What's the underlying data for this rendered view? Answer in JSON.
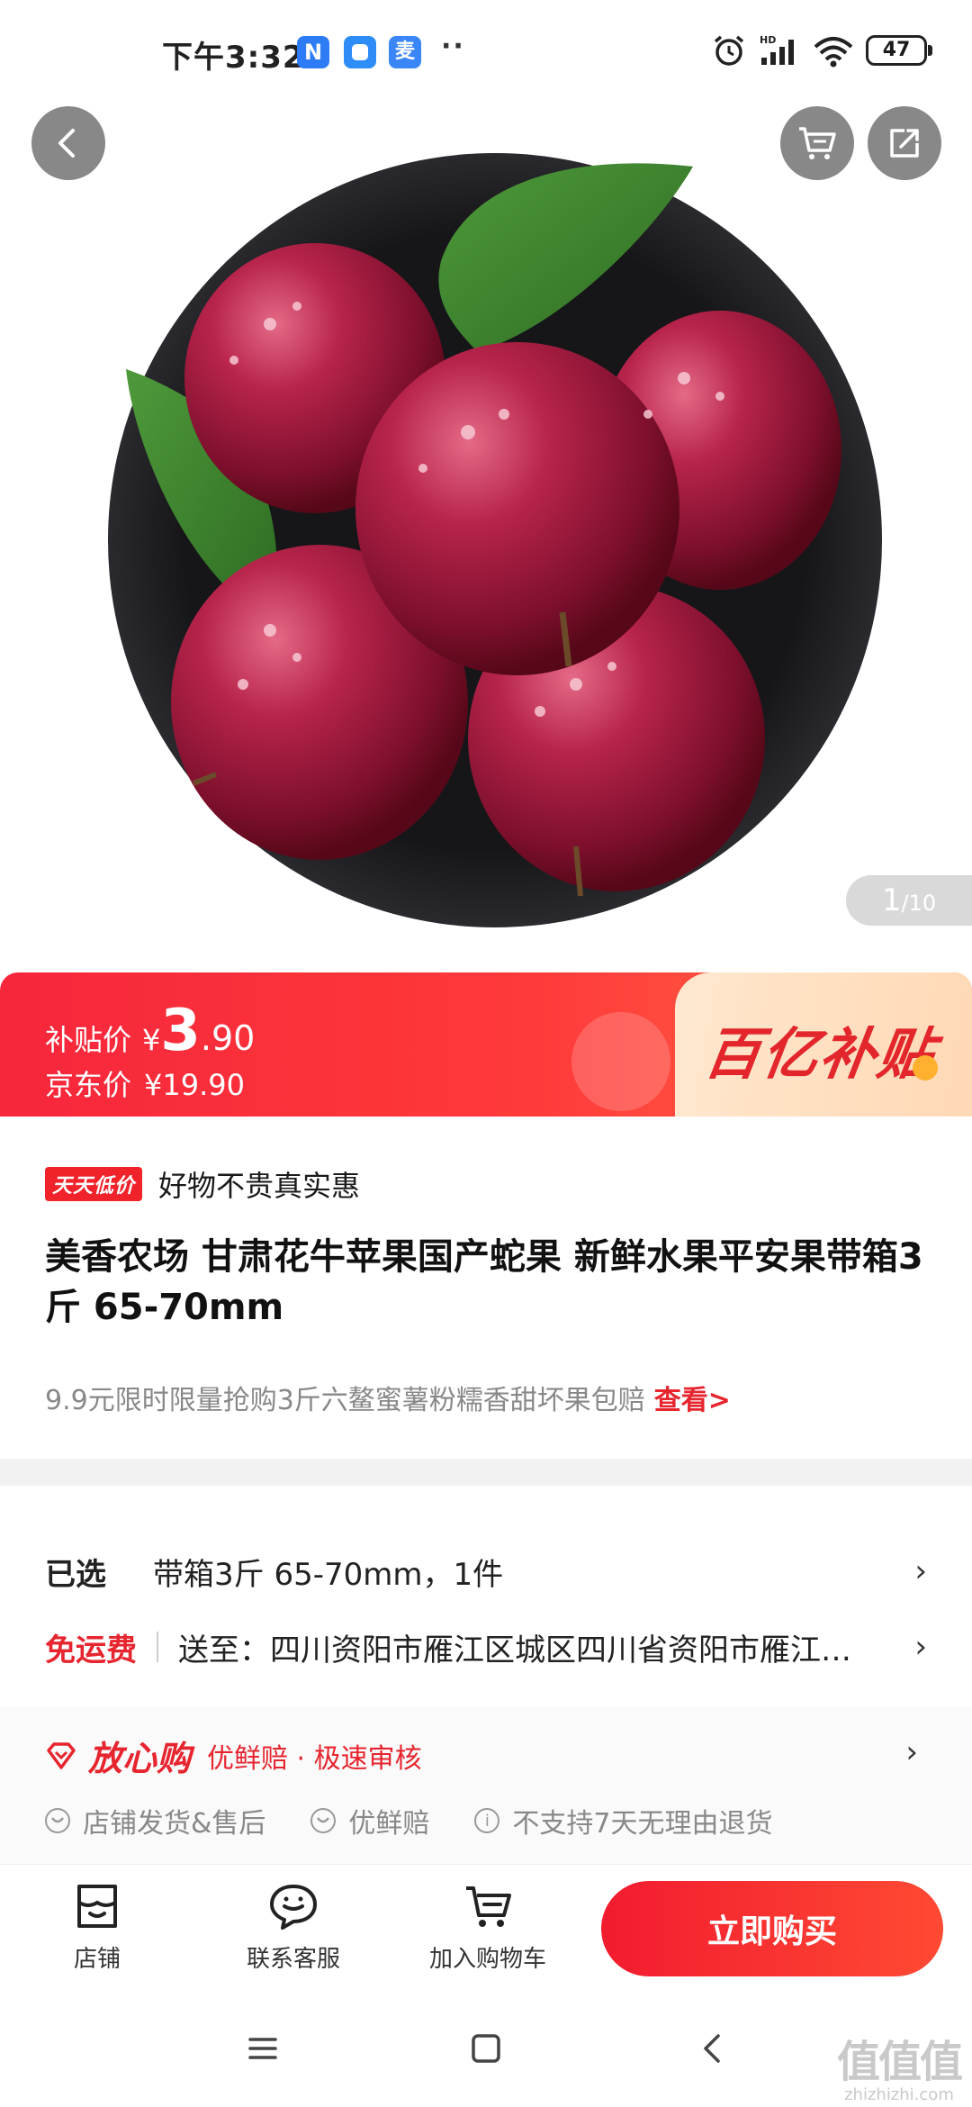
{
  "status_bar": {
    "time": "下午3:32",
    "app_badges": [
      {
        "name": "n-app",
        "glyph": "N",
        "color": "#2d7cf6"
      },
      {
        "name": "square-app",
        "glyph": "",
        "color": "#2d8cf6"
      },
      {
        "name": "mai-app",
        "glyph": "麦",
        "color": "#3b86f7"
      }
    ],
    "more": "··",
    "battery": "47"
  },
  "hero": {
    "page_current": "1",
    "page_total": "/10"
  },
  "price": {
    "subsidy_label": "补贴价",
    "yen": "¥",
    "subsidy_int": "3",
    "subsidy_dec": ".90",
    "jd_label": "京东价",
    "jd_price": "¥19.90",
    "banner_text": "百亿补贴"
  },
  "product": {
    "badge": "天天低价",
    "tagline": "好物不贵真实惠",
    "title": "美香农场  甘肃花牛苹果国产蛇果  新鲜水果平安果带箱3斤 65-70mm",
    "promo_text": "9.9元限时限量抢购3斤六鳌蜜薯粉糯香甜坏果包赔",
    "promo_link": "查看>"
  },
  "selection": {
    "selected_label": "已选",
    "selected_value": "带箱3斤 65-70mm，1件",
    "shipping_label": "免运费",
    "shipping_value": "送至：四川资阳市雁江区城区四川省资阳市雁江…",
    "chevron": "›"
  },
  "assurance": {
    "title": "放心购",
    "subtitle": "优鲜赔 · 极速审核",
    "items": [
      "店铺发货&售后",
      "优鲜赔",
      "不支持7天无理由退货"
    ]
  },
  "bottom_bar": {
    "shop": "店铺",
    "service": "联系客服",
    "cart": "加入购物车",
    "buy": "立即购买"
  },
  "watermark": {
    "top": "值值值",
    "bottom": "zhizhizhi.com"
  },
  "colors": {
    "accent_red": "#e6252f",
    "banner_gradient_start": "#f6263b",
    "banner_gradient_end": "#ff6b47"
  }
}
